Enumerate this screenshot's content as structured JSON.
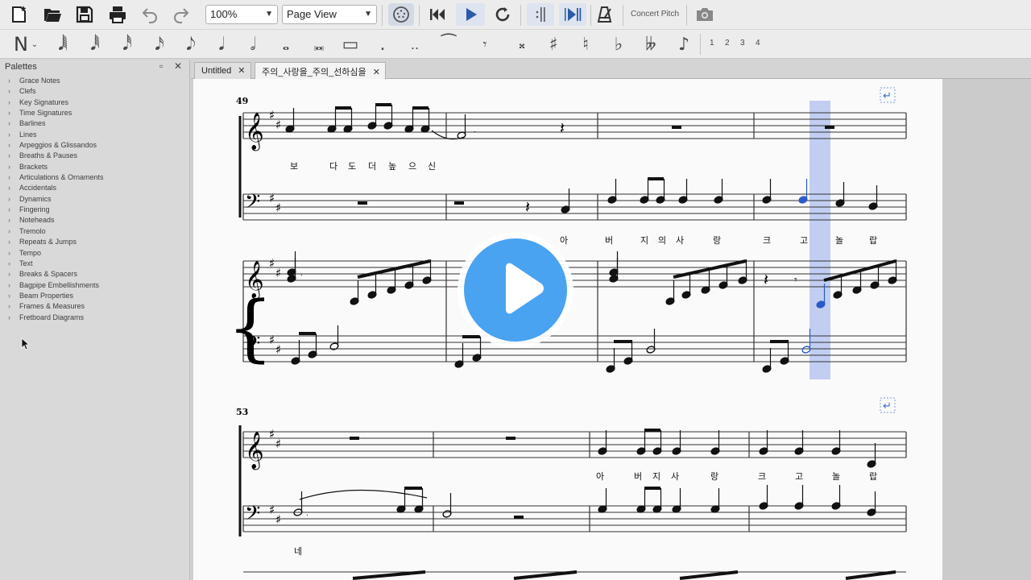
{
  "toolbar": {
    "zoom": "100%",
    "view_mode": "Page View",
    "concert_pitch": "Concert Pitch",
    "voices": [
      "1",
      "2",
      "3",
      "4"
    ]
  },
  "palettes": {
    "title": "Palettes",
    "items": [
      "Grace Notes",
      "Clefs",
      "Key Signatures",
      "Time Signatures",
      "Barlines",
      "Lines",
      "Arpeggios & Glissandos",
      "Breaths & Pauses",
      "Brackets",
      "Articulations & Ornaments",
      "Accidentals",
      "Dynamics",
      "Fingering",
      "Noteheads",
      "Tremolo",
      "Repeats & Jumps",
      "Tempo",
      "Text",
      "Breaks & Spacers",
      "Bagpipe Embellishments",
      "Beam Properties",
      "Frames & Measures",
      "Fretboard Diagrams"
    ]
  },
  "tabs": [
    {
      "label": "Untitled",
      "active": false
    },
    {
      "label": "주의_사랑을_주의_선하심을",
      "active": true
    }
  ],
  "score": {
    "system1": {
      "measure_number": "49",
      "soprano_lyrics": [
        "보",
        "다",
        "도",
        "더",
        "높",
        "으",
        "신"
      ],
      "bass_lyrics": [
        "아",
        "버",
        "지",
        "의",
        "사",
        "랑",
        "크",
        "고",
        "놀",
        "랍"
      ]
    },
    "system2": {
      "measure_number": "53",
      "soprano_lyrics": [
        "아",
        "버",
        "지",
        "사",
        "랑",
        "크",
        "고",
        "놀",
        "랍"
      ],
      "bass_lyrics": [
        "네"
      ]
    }
  },
  "colors": {
    "selection": "#b7c5ee",
    "selected_note": "#2a5bc8",
    "play_button": "#4aa3f0"
  }
}
